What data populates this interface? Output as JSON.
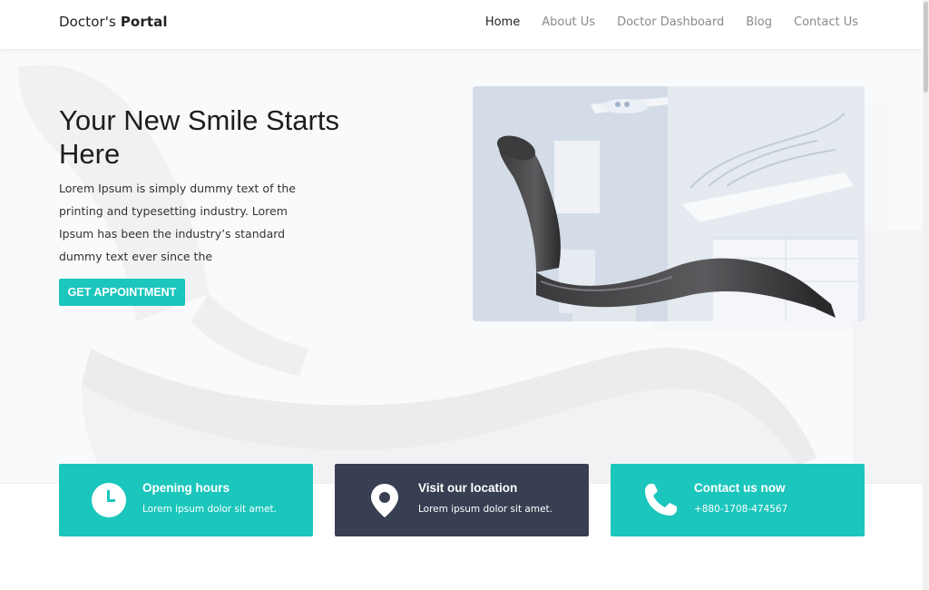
{
  "nav": {
    "brand_prefix": "Doctor's",
    "brand_bold": "Portal",
    "links": [
      {
        "label": "Home"
      },
      {
        "label": "About Us"
      },
      {
        "label": "Doctor Dashboard"
      },
      {
        "label": "Blog"
      },
      {
        "label": "Contact Us"
      }
    ]
  },
  "hero": {
    "title": "Your New Smile Starts Here",
    "text": "Lorem Ipsum is simply dummy text of the printing and typesetting industry. Lorem Ipsum has been the industry’s standard dummy text ever since the",
    "cta_label": "GET APPOINTMENT"
  },
  "cards": [
    {
      "title": "Opening hours",
      "subtitle": "Lorem ipsum dolor sit amet.",
      "icon": "clock-icon",
      "color": "#1bc6bc"
    },
    {
      "title": "Visit our location",
      "subtitle": "Lorem ipsum dolor sit amet.",
      "icon": "map-pin-icon",
      "color": "#383f52"
    },
    {
      "title": "Contact us now",
      "subtitle": "+880-1708-474567",
      "icon": "phone-icon",
      "color": "#1bc6bc"
    }
  ],
  "colors": {
    "accent": "#1bc6bc",
    "dark_card": "#383f52",
    "hero_background": "#f6f7f9"
  }
}
